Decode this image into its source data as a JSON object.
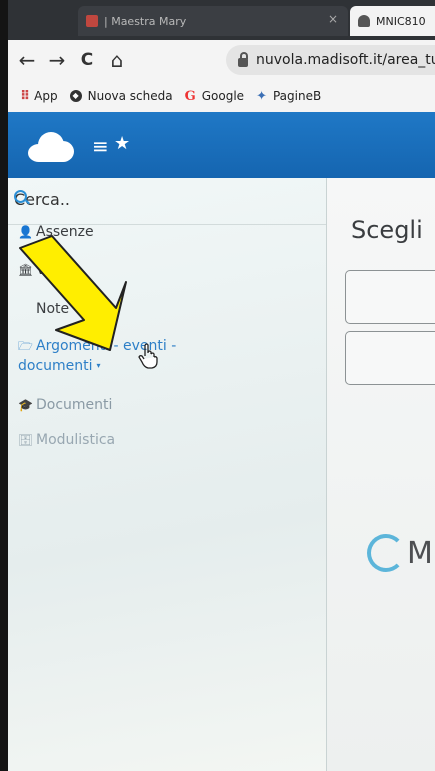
{
  "browser": {
    "tabs": [
      {
        "title": "| Maestra Mary",
        "close": "×"
      },
      {
        "title": "MNIC810"
      }
    ],
    "nav": {
      "back": "←",
      "forward": "→",
      "reload": "C",
      "home": "⌂"
    },
    "url": "nuvola.madisoft.it/area_tu",
    "bookmarks": [
      {
        "icon": "apps-icon",
        "label": "App"
      },
      {
        "icon": "nuova-scheda-icon",
        "label": "Nuova scheda"
      },
      {
        "icon": "google-icon",
        "label": "Google"
      },
      {
        "icon": "pagine-icon",
        "label": "PagineB"
      }
    ]
  },
  "sidebar": {
    "search_placeholder": "Cerca..",
    "items": [
      {
        "label": "Assenze",
        "icon": "user-icon"
      },
      {
        "label": "Voti",
        "icon": "bank-icon",
        "caret": "▾"
      },
      {
        "label": "Note",
        "icon": "note-icon"
      },
      {
        "label": "Argomenti - eventi - ",
        "label2": "documenti",
        "icon": "folder-open-icon",
        "caret": "▾"
      },
      {
        "label": "Documenti",
        "icon": "graduation-cap-icon"
      },
      {
        "label": "Modulistica",
        "icon": "archive-icon"
      }
    ]
  },
  "main": {
    "heading": "Scegli",
    "logo_letter": "M"
  },
  "colors": {
    "header": "#1f78c6",
    "link": "#2d7fc7",
    "annotation_arrow": "#ffee00"
  }
}
